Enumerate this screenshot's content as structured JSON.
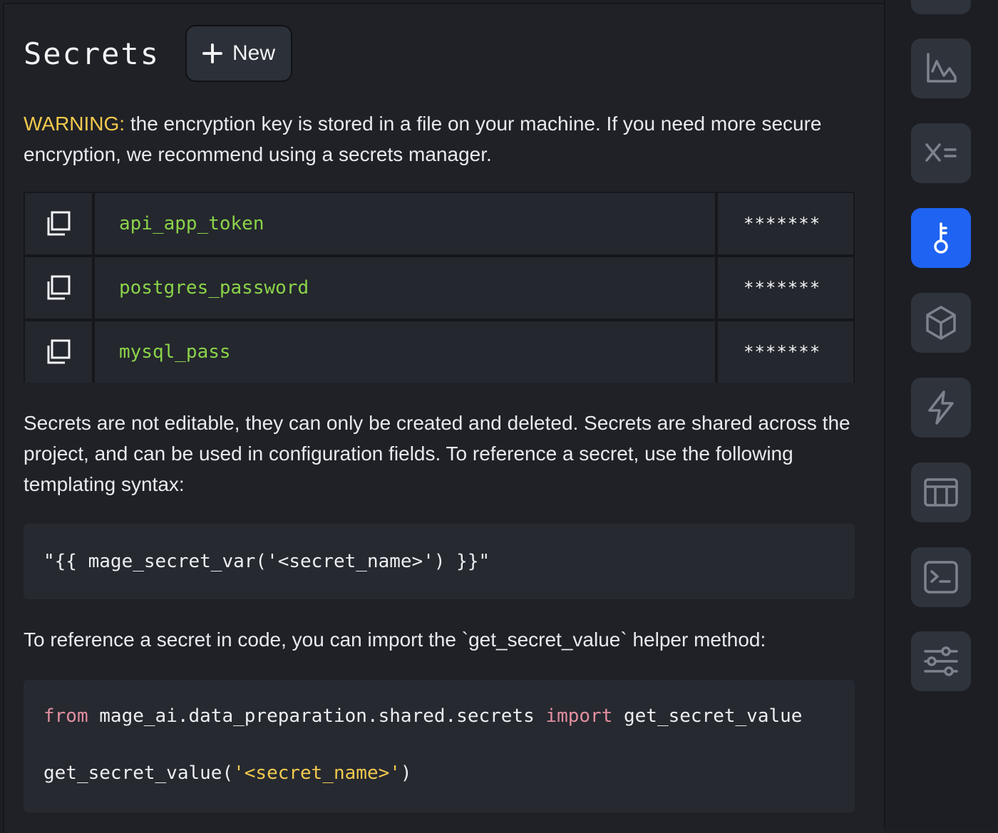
{
  "header": {
    "title": "Secrets",
    "new_button_label": "New"
  },
  "warning": {
    "label": "WARNING:",
    "text": " the encryption key is stored in a file on your machine. If you need more secure encryption, we recommend using a secrets manager."
  },
  "secrets": [
    {
      "name": "api_app_token",
      "value": "*******"
    },
    {
      "name": "postgres_password",
      "value": "*******"
    },
    {
      "name": "mysql_pass",
      "value": "*******"
    }
  ],
  "info_text": "Secrets are not editable, they can only be created and deleted. Secrets are shared across the project, and can be used in configuration fields. To reference a secret, use the following templating syntax:",
  "template_code": "\"{{ mage_secret_var('<secret_name>') }}\"",
  "code_intro": "To reference a secret in code, you can import the `get_secret_value` helper method:",
  "code": {
    "kw_from": "from",
    "module": " mage_ai.data_preparation.shared.secrets ",
    "kw_import": "import",
    "func_import": " get_secret_value",
    "call_prefix": "get_secret_value(",
    "call_arg": "'<secret_name>'",
    "call_suffix": ")"
  },
  "rail": {
    "icons": [
      "chart-icon",
      "variables-icon",
      "secrets-key-icon",
      "package-cube-icon",
      "lightning-icon",
      "table-icon",
      "terminal-icon",
      "settings-sliders-icon"
    ],
    "active": "secrets-key-icon"
  }
}
